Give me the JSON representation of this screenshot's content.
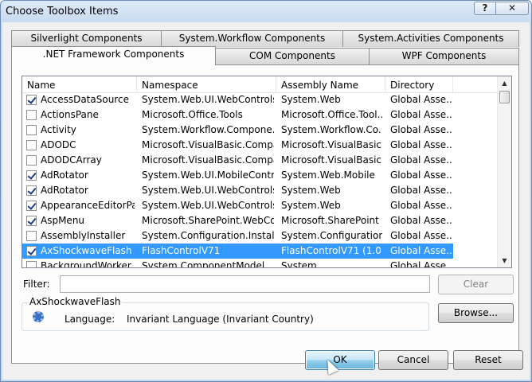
{
  "window": {
    "title": "Choose Toolbox Items",
    "help_label": "?",
    "close_label": "✕"
  },
  "tabs": {
    "row1": [
      "Silverlight Components",
      "System.Workflow Components",
      "System.Activities Components"
    ],
    "row2": [
      ".NET Framework Components",
      "COM Components",
      "WPF Components"
    ],
    "active": ".NET Framework Components"
  },
  "columns": [
    "Name",
    "Namespace",
    "Assembly Name",
    "Directory"
  ],
  "rows": [
    {
      "checked": true,
      "name": "AccessDataSource",
      "namespace": "System.Web.UI.WebControls",
      "assembly": "System.Web",
      "directory": "Global Asse..."
    },
    {
      "checked": false,
      "name": "ActionsPane",
      "namespace": "Microsoft.Office.Tools",
      "assembly": "Microsoft.Office.Tool...",
      "directory": "Global Asse..."
    },
    {
      "checked": false,
      "name": "Activity",
      "namespace": "System.Workflow.Compone...",
      "assembly": "System.Workflow.Co...",
      "directory": "Global Asse..."
    },
    {
      "checked": false,
      "name": "ADODC",
      "namespace": "Microsoft.VisualBasic.Compa...",
      "assembly": "Microsoft.VisualBasic....",
      "directory": "Global Asse..."
    },
    {
      "checked": false,
      "name": "ADODCArray",
      "namespace": "Microsoft.VisualBasic.Compa...",
      "assembly": "Microsoft.VisualBasic....",
      "directory": "Global Asse..."
    },
    {
      "checked": true,
      "name": "AdRotator",
      "namespace": "System.Web.UI.MobileContr...",
      "assembly": "System.Web.Mobile",
      "directory": "Global Asse..."
    },
    {
      "checked": true,
      "name": "AdRotator",
      "namespace": "System.Web.UI.WebControls",
      "assembly": "System.Web",
      "directory": "Global Asse..."
    },
    {
      "checked": true,
      "name": "AppearanceEditorPart",
      "namespace": "System.Web.UI.WebControls....",
      "assembly": "System.Web",
      "directory": "Global Asse..."
    },
    {
      "checked": true,
      "name": "AspMenu",
      "namespace": "Microsoft.SharePoint.WebCo...",
      "assembly": "Microsoft.SharePoint ...",
      "directory": "Global Asse..."
    },
    {
      "checked": false,
      "name": "AssemblyInstaller",
      "namespace": "System.Configuration.Install",
      "assembly": "System.Configuration...",
      "directory": "Global Asse..."
    },
    {
      "checked": true,
      "name": "AxShockwaveFlash",
      "namespace": "FlashControlV71",
      "assembly": "FlashControlV71 (1.0....",
      "directory": "Global Asse...",
      "selected": true
    },
    {
      "checked": false,
      "name": "BackgroundWorker",
      "namespace": "System.ComponentModel",
      "assembly": "System",
      "directory": "Global Asse..."
    }
  ],
  "filter": {
    "label": "Filter:",
    "value": "",
    "clear_label": "Clear"
  },
  "details": {
    "title": "AxShockwaveFlash",
    "language_label": "Language:",
    "language_value": "Invariant Language (Invariant Country)",
    "browse_label": "Browse..."
  },
  "buttons": {
    "ok": "OK",
    "cancel": "Cancel",
    "reset": "Reset"
  }
}
